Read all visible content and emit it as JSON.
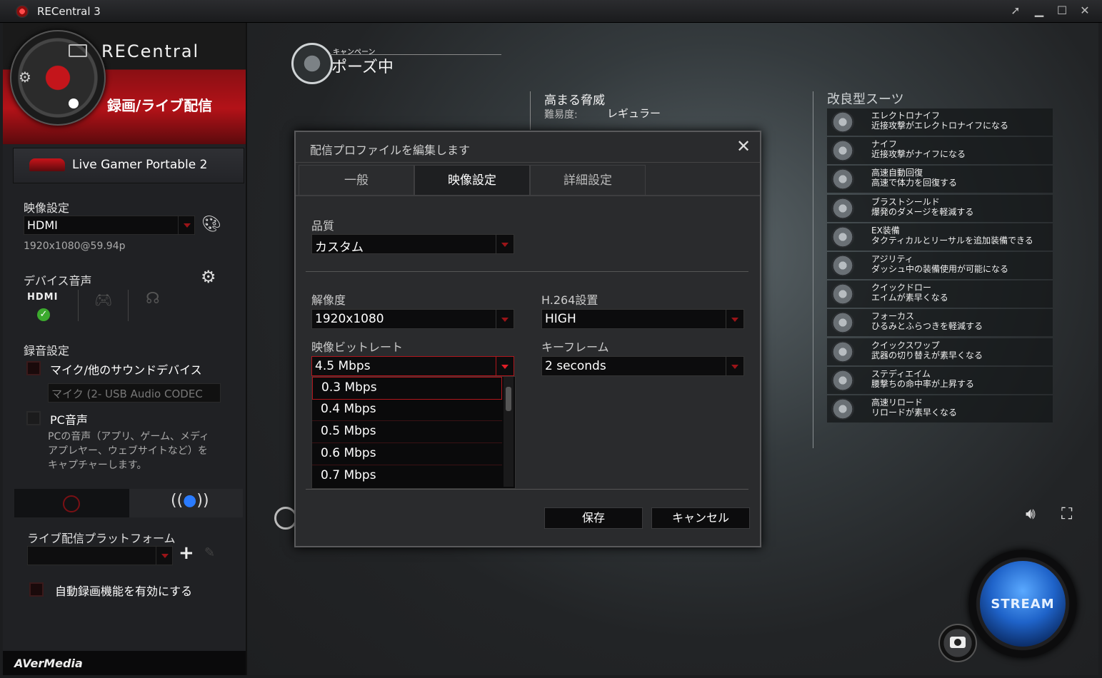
{
  "window": {
    "title": "RECentral 3"
  },
  "sidebar": {
    "brand": "RECentral",
    "mode": "録画/ライブ配信",
    "device": "Live Gamer Portable 2",
    "video_settings_label": "映像設定",
    "video_source": "HDMI",
    "video_signal": "1920x1080@59.94p",
    "device_audio_label": "デバイス音声",
    "audio_hdmi": "HDMI",
    "record_settings_label": "録音設定",
    "mic_label": "マイク/他のサウンドデバイス",
    "mic_device": "マイク (2- USB Audio CODEC",
    "pc_audio_label": "PC音声",
    "pc_audio_desc": "PCの音声（アプリ、ゲーム、メディアプレヤー、ウェブサイトなど）をキャプチャーします。",
    "platform_label": "ライブ配信プラットフォーム",
    "platform_value": "",
    "auto_record_label": "自動録画機能を有効にする",
    "footer_logo": "AVerMedia"
  },
  "game": {
    "campaign_small": "キャンペーン",
    "campaign_status": "ポーズ中",
    "mission_title": "高まる脅威",
    "difficulty_label": "難易度:",
    "difficulty_value": "レギュラー",
    "suits_title": "改良型スーツ",
    "suits": [
      {
        "name": "エレクトロナイフ",
        "desc": "近接攻撃がエレクトロナイフになる"
      },
      {
        "name": "ナイフ",
        "desc": "近接攻撃がナイフになる"
      },
      {
        "name": "高速自動回復",
        "desc": "高速で体力を回復する"
      },
      {
        "name": "ブラストシールド",
        "desc": "爆発のダメージを軽減する"
      },
      {
        "name": "EX装備",
        "desc": "タクティカルとリーサルを追加装備できる"
      },
      {
        "name": "アジリティ",
        "desc": "ダッシュ中の装備使用が可能になる"
      },
      {
        "name": "クイックドロー",
        "desc": "エイムが素早くなる"
      },
      {
        "name": "フォーカス",
        "desc": "ひるみとふらつきを軽減する"
      },
      {
        "name": "クイックスワップ",
        "desc": "武器の切り替えが素早くなる"
      },
      {
        "name": "ステディエイム",
        "desc": "腰撃ちの命中率が上昇する"
      },
      {
        "name": "高速リロード",
        "desc": "リロードが素早くなる"
      }
    ]
  },
  "dialog": {
    "title": "配信プロファイルを編集します",
    "tabs": [
      "一般",
      "映像設定",
      "詳細設定"
    ],
    "active_tab": "映像設定",
    "quality_label": "品質",
    "quality_value": "カスタム",
    "resolution_label": "解像度",
    "resolution_value": "1920x1080",
    "h264_label": "H.264設置",
    "h264_value": "HIGH",
    "bitrate_label": "映像ビットレート",
    "bitrate_value": "4.5 Mbps",
    "keyframe_label": "キーフレーム",
    "keyframe_value": "2 seconds",
    "bitrate_options": [
      "0.3 Mbps",
      "0.4 Mbps",
      "0.5 Mbps",
      "0.6 Mbps",
      "0.7 Mbps"
    ],
    "save": "保存",
    "cancel": "キャンセル"
  },
  "stream": {
    "label": "STREAM"
  },
  "colors": {
    "accent_red": "#b31218",
    "stream_blue": "#1f63c9"
  }
}
